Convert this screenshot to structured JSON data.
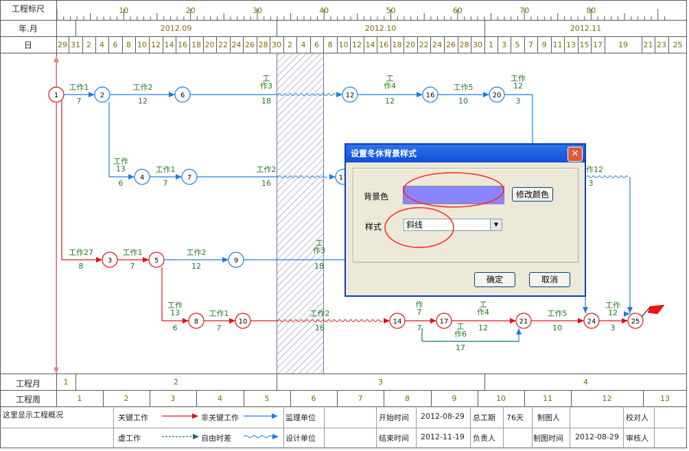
{
  "header": {
    "scale_label": "工程标尺",
    "scale_ticks": [
      "10",
      "20",
      "30",
      "40",
      "50",
      "60",
      "70",
      "80"
    ],
    "month_label": "年.月",
    "months": [
      "2012.09",
      "2012.10",
      "2012.11"
    ],
    "day_label": "日",
    "days": [
      "29",
      "31",
      "2",
      "4",
      "6",
      "8",
      "10",
      "12",
      "14",
      "16",
      "18",
      "20",
      "22",
      "24",
      "26",
      "28",
      "30",
      "2",
      "4",
      "6",
      "8",
      "10",
      "12",
      "14",
      "16",
      "18",
      "20",
      "22",
      "24",
      "26",
      "28",
      "30",
      "1",
      "3",
      "5",
      "7",
      "9",
      "11",
      "13",
      "15",
      "17",
      "19",
      "21",
      "23",
      "25"
    ]
  },
  "footer": {
    "eng_month_label": "工程月",
    "eng_months": [
      "1",
      "2",
      "3",
      "4"
    ],
    "eng_week_label": "工程周",
    "eng_weeks": [
      "1",
      "2",
      "3",
      "4",
      "5",
      "6",
      "7",
      "8",
      "9",
      "10",
      "11",
      "12",
      "13"
    ]
  },
  "legend": {
    "overview": "这里显示工程概况",
    "critical": "关键工作",
    "noncritical": "非关键工作",
    "dummy": "虚工作",
    "free_float": "自由时差",
    "supervisor": "监理单位",
    "designer": "设计单位",
    "start_label": "开始时间",
    "start_value": "2012-08-29",
    "end_label": "结束时间",
    "end_value": "2012-11-19",
    "total_label": "总工期",
    "total_value": "76天",
    "owner_label": "负责人",
    "drawer_label": "制图人",
    "draw_time_label": "制图时间",
    "draw_time_value": "2012-08-29",
    "checker_label": "校对人",
    "reviewer_label": "审核人"
  },
  "network": {
    "colors": {
      "critical": "#e01010",
      "noncritical": "#1a7ee0",
      "text": "#1a7a1a",
      "winter": "#7070a0"
    },
    "nodes": [
      {
        "id": "1",
        "crit": true
      },
      {
        "id": "2",
        "crit": false
      },
      {
        "id": "6",
        "crit": false
      },
      {
        "id": "12",
        "crit": false
      },
      {
        "id": "16",
        "crit": false
      },
      {
        "id": "20",
        "crit": false
      },
      {
        "id": "4",
        "crit": false
      },
      {
        "id": "7",
        "crit": false
      },
      {
        "id": "11",
        "crit": false
      },
      {
        "id": "3",
        "crit": true
      },
      {
        "id": "5",
        "crit": true
      },
      {
        "id": "9",
        "crit": false
      },
      {
        "id": "8",
        "crit": true
      },
      {
        "id": "10",
        "crit": true
      },
      {
        "id": "14",
        "crit": true
      },
      {
        "id": "17",
        "crit": true
      },
      {
        "id": "21",
        "crit": true
      },
      {
        "id": "24",
        "crit": true
      },
      {
        "id": "25",
        "crit": true
      }
    ],
    "tasks": [
      {
        "name": "工作1",
        "dur": "7"
      },
      {
        "name": "工作2",
        "dur": "12"
      },
      {
        "name": "工",
        "name2": "作3",
        "dur": "18"
      },
      {
        "name": "工",
        "name2": "作4",
        "dur": "12"
      },
      {
        "name": "工作5",
        "dur": "10"
      },
      {
        "name": "工作",
        "name2": "12",
        "dur": "3"
      },
      {
        "name": "工作",
        "name2": "13",
        "dur": "6"
      },
      {
        "name": "工作1",
        "dur": "7"
      },
      {
        "name": "工作2",
        "dur": "16"
      },
      {
        "name": "工作12",
        "dur": "3"
      },
      {
        "name": "工作27",
        "dur": "8"
      },
      {
        "name": "工作1",
        "dur": "7"
      },
      {
        "name": "工作2",
        "dur": "12"
      },
      {
        "name": "工",
        "name2": "作3",
        "dur": "18"
      },
      {
        "name": "工作",
        "name2": "13",
        "dur": "6"
      },
      {
        "name": "工作1",
        "dur": "7"
      },
      {
        "name": "工作2",
        "dur": "16"
      },
      {
        "name": "作",
        "name2": "7",
        "dur": "7"
      },
      {
        "name": "工",
        "name2": "作4",
        "dur": "12"
      },
      {
        "name": "工作5",
        "dur": "10"
      },
      {
        "name": "工作",
        "name2": "12",
        "dur": "3"
      },
      {
        "name": "工",
        "name2": "作6",
        "dur": "17"
      }
    ]
  },
  "dialog": {
    "title": "设置冬休背景样式",
    "close": "✕",
    "bg_label": "背景色",
    "modify_color": "修改颜色",
    "style_label": "样式",
    "style_value": "斜线",
    "ok": "确定",
    "cancel": "取消",
    "swatch_color": "#8a85ff"
  }
}
